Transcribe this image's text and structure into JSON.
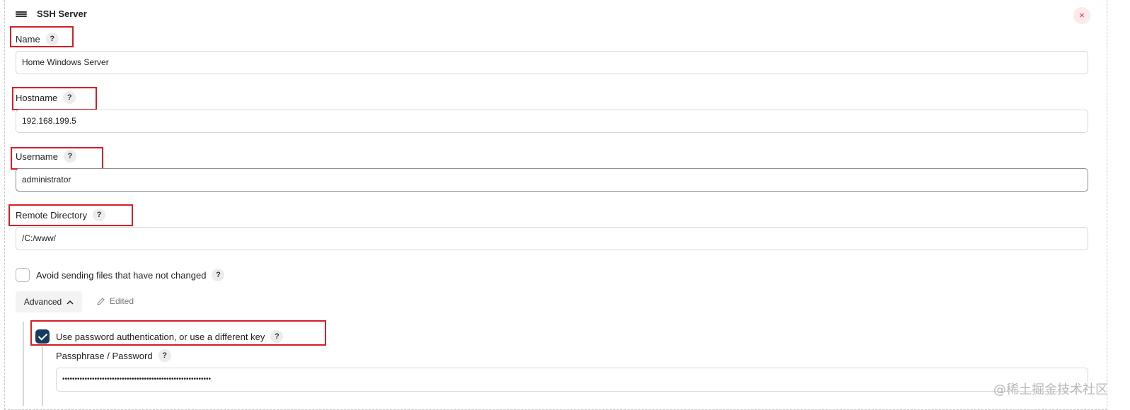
{
  "header": {
    "title": "SSH Server",
    "close_glyph": "×"
  },
  "fields": {
    "name": {
      "label": "Name",
      "value": "Home Windows Server"
    },
    "hostname": {
      "label": "Hostname",
      "value": "192.168.199.5"
    },
    "username": {
      "label": "Username",
      "value": "administrator"
    },
    "remote_directory": {
      "label": "Remote Directory",
      "value": "/C:/www/"
    },
    "passphrase": {
      "label": "Passphrase / Password",
      "value": "••••••••••••••••••••••••••••••••••••••••••••••••••••••••••••"
    }
  },
  "help_glyph": "?",
  "options": {
    "avoid_sending": {
      "label": "Avoid sending files that have not changed",
      "checked": false
    },
    "use_password_auth": {
      "label": "Use password authentication, or use a different key",
      "checked": true
    }
  },
  "advanced": {
    "label": "Advanced",
    "chevron": "^",
    "edited_label": "Edited"
  },
  "watermark": "@稀土掘金技术社区",
  "colors": {
    "highlight_box": "#d41e26",
    "checkbox_checked": "#183a5e",
    "close_button_bg": "#fde8ea",
    "close_button_fg": "#d6334a"
  },
  "icons": {
    "drag": "drag-handle-icon",
    "close": "close-icon",
    "help": "question-mark-icon",
    "chevron": "chevron-up-icon",
    "pencil": "pencil-icon"
  }
}
